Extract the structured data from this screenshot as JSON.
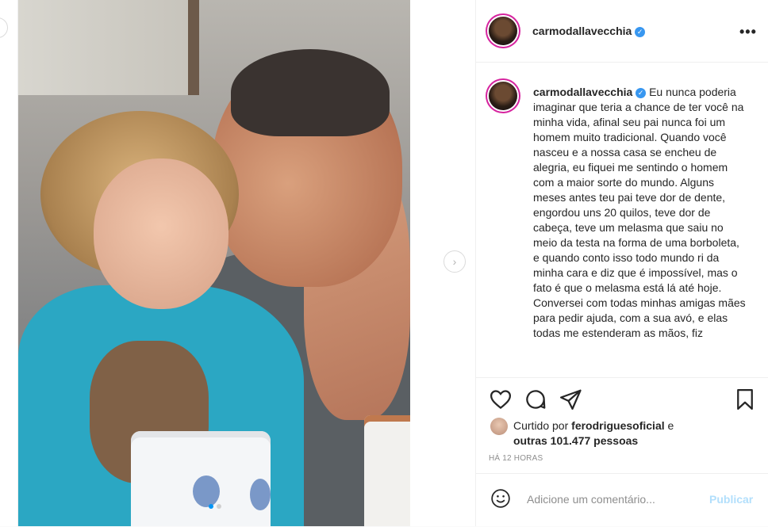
{
  "post": {
    "username": "carmodallavecchia",
    "verified_icon": "verified-badge-icon",
    "more_icon": "more-options-icon",
    "caption": "Eu nunca poderia imaginar que teria a chance de ter você na minha vida, afinal seu pai nunca foi um homem muito tradicional. Quando você nasceu e a nossa casa se encheu de alegria, eu fiquei me sentindo o homem com a maior sorte do mundo. Alguns meses antes teu pai teve dor de dente, engordou uns 20 quilos, teve dor de cabeça, teve um melasma que saiu no meio da testa na forma de uma borboleta, e quando conto isso todo mundo ri da minha cara e diz que é impossível, mas o fato é que o melasma está lá até hoje. Conversei com todas minhas amigas mães para pedir ajuda, com a sua avó, e elas todas me estenderam as mãos, fiz"
  },
  "media": {
    "carousel_total": 2,
    "carousel_current": 1,
    "next_icon": "chevron-right-icon"
  },
  "actions": {
    "icons": [
      "heart-icon",
      "comment-icon",
      "share-icon",
      "bookmark-icon"
    ]
  },
  "likes": {
    "prefix": "Curtido por",
    "liked_by": "ferodriguesoficial",
    "connector": "e",
    "others": "outras 101.477 pessoas"
  },
  "timestamp": "HÁ 12 HORAS",
  "comment": {
    "placeholder": "Adicione um comentário...",
    "publish_label": "Publicar",
    "emoji_icon": "emoji-icon"
  },
  "colors": {
    "link_blue": "#3897f0",
    "publish_disabled": "#b2dffc",
    "muted_text": "#8e8e8e",
    "border": "#efefef"
  }
}
